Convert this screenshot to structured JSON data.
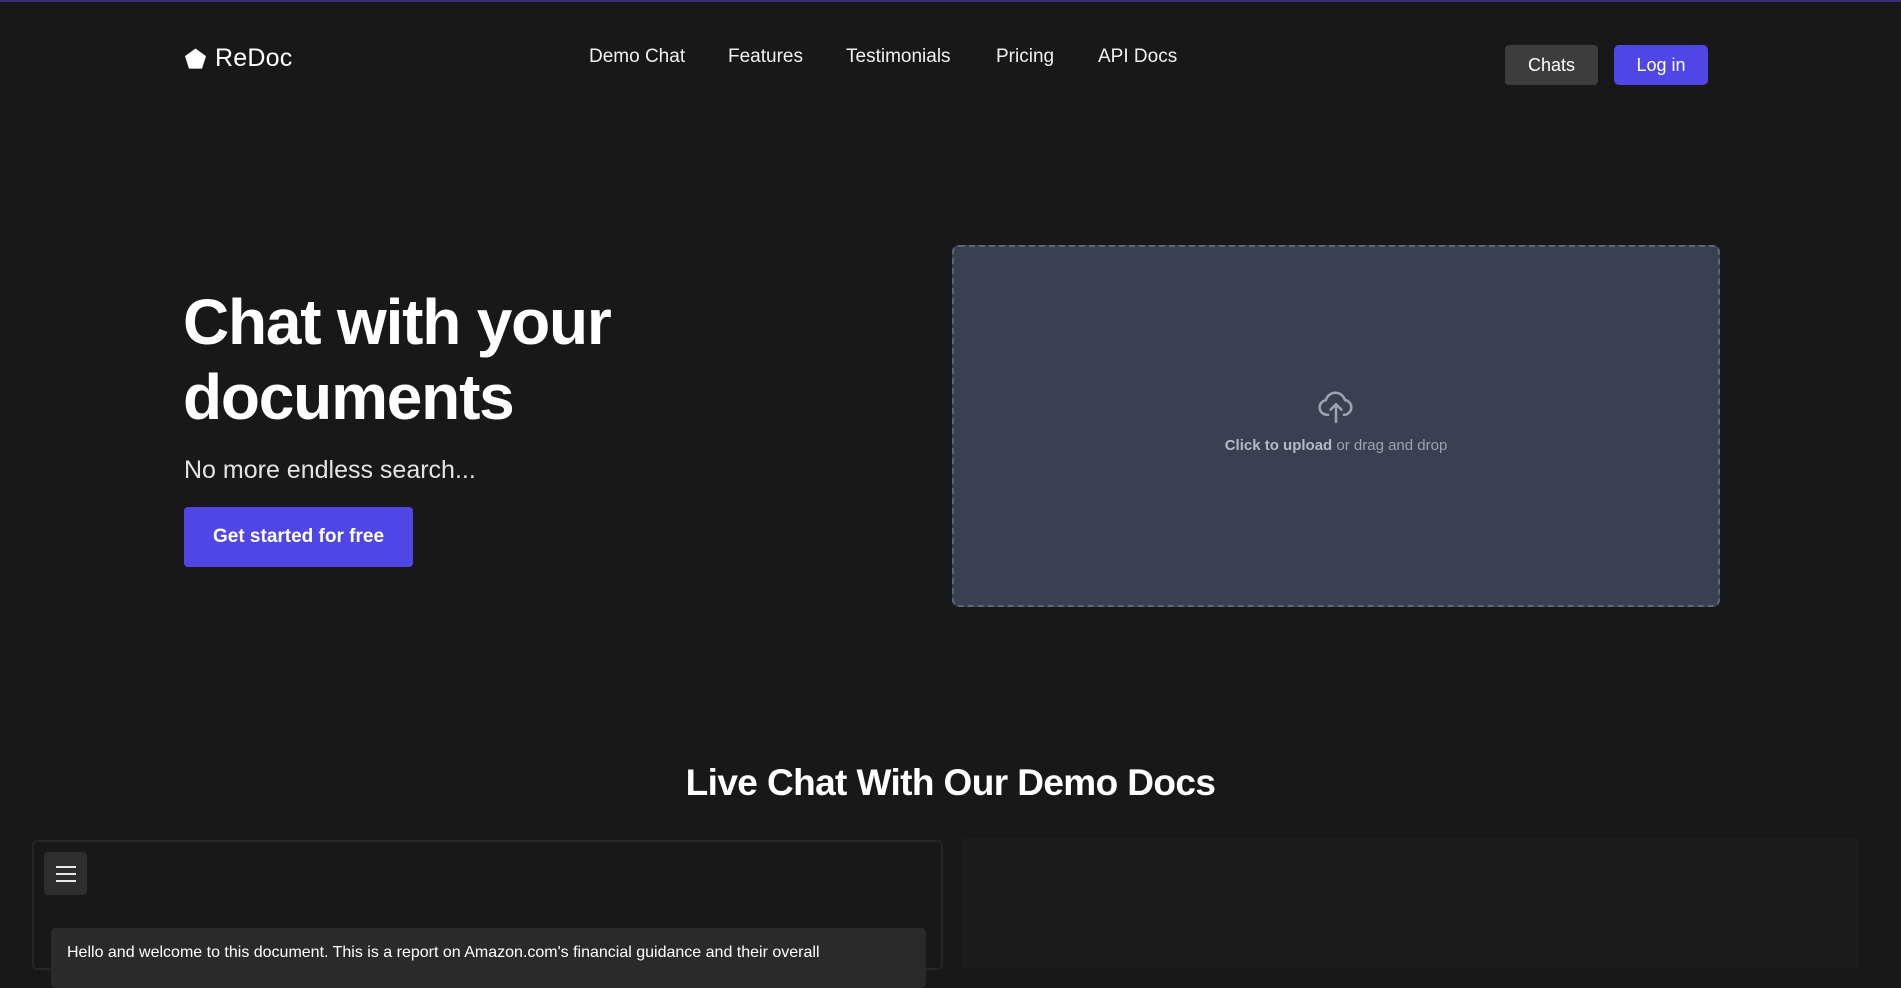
{
  "brand": {
    "name": "ReDoc",
    "icon": "pentagon-icon"
  },
  "nav": {
    "links": [
      {
        "label": "Demo Chat"
      },
      {
        "label": "Features"
      },
      {
        "label": "Testimonials"
      },
      {
        "label": "Pricing"
      },
      {
        "label": "API Docs"
      }
    ],
    "chats_label": "Chats",
    "login_label": "Log in"
  },
  "hero": {
    "title_line1": "Chat with your",
    "title_line2": "documents",
    "subtitle": "No more endless search...",
    "cta_label": "Get started for free"
  },
  "upload": {
    "icon": "cloud-upload-icon",
    "click_label": "Click to upload",
    "drag_label": " or drag and drop"
  },
  "demo": {
    "section_title": "Live Chat With Our Demo Docs",
    "menu_icon": "hamburger-menu-icon",
    "first_message": "Hello and welcome to this document. This is a report on Amazon.com's financial guidance and their overall"
  },
  "colors": {
    "background": "#181818",
    "accent": "#4f46e5",
    "dropzone": "#374151",
    "secondary_button": "#3d3d3d"
  }
}
